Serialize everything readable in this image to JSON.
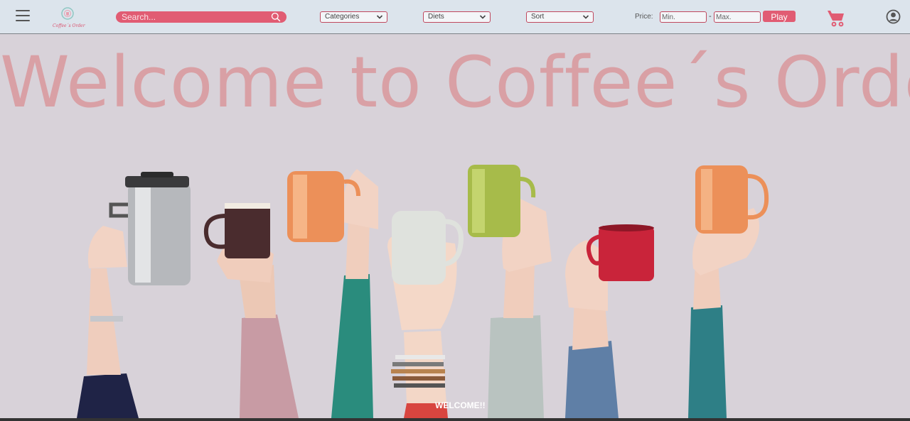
{
  "nav": {
    "logo_text": "Coffee´s Order",
    "search_placeholder": "Search...",
    "categories_label": "Categories",
    "diets_label": "Diets",
    "sort_label": "Sort",
    "price_label": "Price:",
    "min_placeholder": "Min.",
    "max_placeholder": "Max.",
    "dash": "-",
    "play_label": "Play",
    "icons": [
      "menu-icon",
      "search-icon",
      "chevron-down-icon",
      "cart-icon",
      "user-icon"
    ]
  },
  "hero": {
    "title": "Welcome to Coffee´s Order",
    "welcome_text": "WELCOME!!"
  },
  "colors": {
    "accent": "#e15c73",
    "navbar_bg": "#dce4ec",
    "hero_bg": "#d8d2d9",
    "title_color": "#d9a0a5"
  }
}
